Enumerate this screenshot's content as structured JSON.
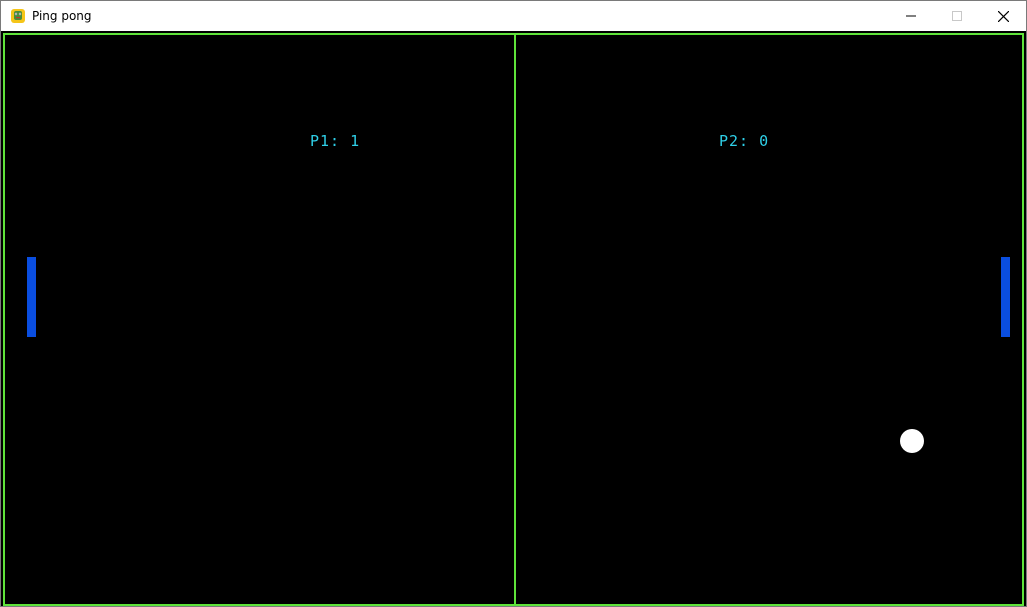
{
  "window": {
    "title": "Ping pong",
    "app_icon": "pygame-snake-icon",
    "controls": {
      "minimize_icon": "minimize-icon",
      "maximize_icon": "maximize-icon",
      "close_icon": "close-icon"
    }
  },
  "game": {
    "score_p1": "P1: 1",
    "score_p2": "P2: 0",
    "colors": {
      "background": "#000000",
      "border": "#5fe33a",
      "score_text": "#2fd0e8",
      "paddle": "#0a4ee0",
      "ball": "#ffffff"
    }
  }
}
